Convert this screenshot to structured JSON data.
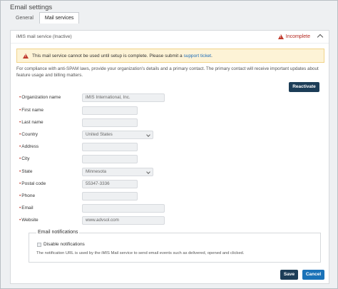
{
  "page": {
    "title": "Email settings"
  },
  "tabs": [
    {
      "label": "General",
      "active": false
    },
    {
      "label": "Mail services",
      "active": true
    }
  ],
  "panel": {
    "title": "iMIS mail service (Inactive)",
    "status": "Incomplete",
    "status_color": "#b3261e"
  },
  "alert": {
    "text": "This mail service cannot be used until setup is complete. Please submit a",
    "link": "support ticket",
    "tail": "."
  },
  "intro": "For compliance with anti-SPAM laws, provide your organization's details and a primary contact. The primary contact will receive important updates about feature usage and billing matters.",
  "buttons": {
    "reactivate": "Reactivate",
    "save": "Save",
    "cancel": "Cancel"
  },
  "fields": {
    "organization_name": {
      "label": "Organization name",
      "value": "iMIS International, Inc."
    },
    "first_name": {
      "label": "First name",
      "value": ""
    },
    "last_name": {
      "label": "Last name",
      "value": ""
    },
    "country": {
      "label": "Country",
      "value": "United States"
    },
    "address": {
      "label": "Address",
      "value": ""
    },
    "city": {
      "label": "City",
      "value": ""
    },
    "state": {
      "label": "State",
      "value": "Minnesota"
    },
    "postal_code": {
      "label": "Postal code",
      "value": "55347-3336"
    },
    "phone": {
      "label": "Phone",
      "value": ""
    },
    "email": {
      "label": "Email",
      "value": ""
    },
    "website": {
      "label": "Website",
      "value": "www.advsol.com"
    }
  },
  "notifications": {
    "legend": "Email notifications",
    "checkbox_label": "Disable notifications",
    "help": "The notification URL is used by the iMIS Mail service to send email events such as delivered, opened and clicked."
  },
  "colors": {
    "primary": "#1c3d57",
    "accent": "#1a72b8",
    "warning_bg": "#fdf3d6"
  }
}
